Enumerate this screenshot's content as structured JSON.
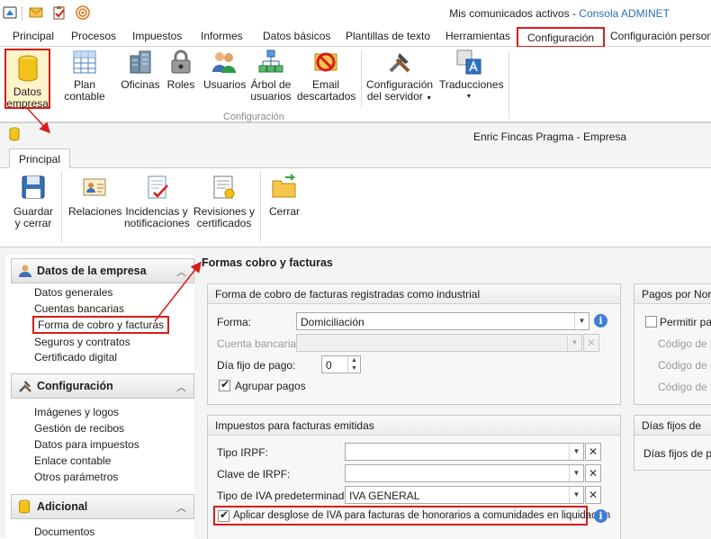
{
  "app": {
    "title": "Mis comunicados activos",
    "subtitle": "Consola ADMINET"
  },
  "menu": {
    "tabs": [
      "Principal",
      "Procesos",
      "Impuestos",
      "Informes",
      "Datos básicos",
      "Plantillas de texto",
      "Herramientas",
      "Configuración",
      "Configuración personal"
    ],
    "active_index": 7
  },
  "ribbon": {
    "buttons": [
      {
        "label": "Datos empresa",
        "icon": "database-icon"
      },
      {
        "label": "Plan contable",
        "icon": "spreadsheet-icon"
      },
      {
        "label": "Oficinas",
        "icon": "buildings-icon"
      },
      {
        "label": "Roles",
        "icon": "lock-icon"
      },
      {
        "label": "Usuarios",
        "icon": "users-icon"
      },
      {
        "label": "Árbol de usuarios",
        "icon": "tree-icon"
      },
      {
        "label": "Email descartados",
        "icon": "blocked-mail-icon"
      },
      {
        "label": "Configuración del servidor",
        "icon": "tools-icon"
      },
      {
        "label": "Traducciones",
        "icon": "translate-icon"
      }
    ],
    "group_label": "Configuración"
  },
  "window": {
    "title": "Enric Fincas Pragma - Empresa",
    "tab": "Principal",
    "buttons": [
      {
        "label": "Guardar y cerrar",
        "icon": "save-icon"
      },
      {
        "label": "Relaciones",
        "icon": "contacts-icon"
      },
      {
        "label": "Incidencias y notificaciones",
        "icon": "checklist-icon"
      },
      {
        "label": "Revisiones y certificados",
        "icon": "certificate-icon"
      },
      {
        "label": "Cerrar",
        "icon": "folder-icon"
      }
    ]
  },
  "sidebar": {
    "groups": [
      {
        "title": "Datos de la empresa",
        "icon": "user-icon",
        "items": [
          "Datos generales",
          "Cuentas bancarias",
          "Forma de cobro y facturas",
          "Seguros y contratos",
          "Certificado digital"
        ]
      },
      {
        "title": "Configuración",
        "icon": "tools-icon",
        "items": [
          "Imágenes y logos",
          "Gestión de recibos",
          "Datos para impuestos",
          "Enlace contable",
          "Otros parámetros"
        ]
      },
      {
        "title": "Adicional",
        "icon": "database-icon",
        "items": [
          "Documentos"
        ]
      }
    ],
    "selected_item": "Forma de cobro y facturas"
  },
  "content": {
    "section_title": "Formas cobro y facturas",
    "cobro": {
      "title": "Forma de cobro de facturas registradas como industrial",
      "forma_label": "Forma:",
      "forma_value": "Domiciliación",
      "cuenta_label": "Cuenta bancaria:",
      "cuenta_value": "",
      "dia_label": "Día fijo de pago:",
      "dia_value": "0",
      "agrupar_label": "Agrupar pagos",
      "agrupar_checked": true
    },
    "impuestos": {
      "title": "Impuestos para facturas emitidas",
      "irpf_label": "Tipo IRPF:",
      "irpf_value": "",
      "clave_label": "Clave de IRPF:",
      "clave_value": "",
      "iva_label": "Tipo de IVA predeterminado:",
      "iva_value": "IVA GENERAL",
      "desglose_label": "Aplicar desglose de IVA para facturas de honorarios a comunidades en liquidación",
      "desglose_checked": true
    },
    "pagos": {
      "title": "Pagos por Norm",
      "permitir_label": "Permitir pag",
      "codigo1": "Código de p",
      "codigo2": "Código de m",
      "codigo3": "Código de tr"
    },
    "dias": {
      "title": "Días fijos de",
      "label": "Días fijos de pa"
    }
  },
  "colors": {
    "highlight": "#d81c1c",
    "accent": "#2d6fb6",
    "info": "#3e7ed6"
  }
}
